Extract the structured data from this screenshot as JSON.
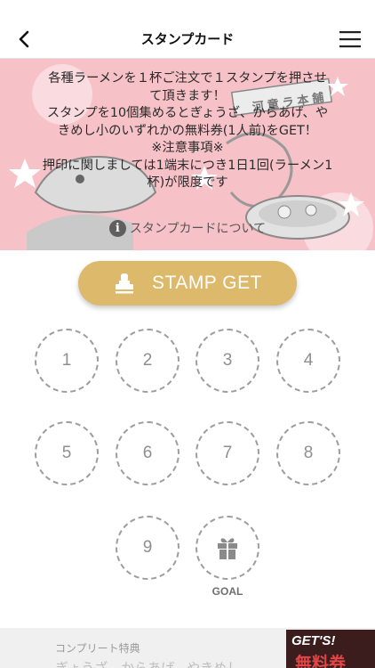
{
  "nav": {
    "title": "スタンプカード"
  },
  "banner": {
    "lines": [
      "各種ラーメンを１杯ご注文で１スタンプを押させ",
      "て頂きます！",
      "スタンプを10個集めるとぎょうざ、からあげ、や",
      "きめし小のいずれかの無料券(1人前)をGET！",
      "※注意事項※",
      "押印に関しましては1端末につき1日1回(ラーメン1",
      "杯)が限度です"
    ],
    "about_label": "スタンプカードについて",
    "sign_text": "河童ラ本舗"
  },
  "stamp_button": {
    "label": "STAMP GET",
    "icon": "stamp-icon"
  },
  "slots": [
    "1",
    "2",
    "3",
    "4",
    "5",
    "6",
    "7",
    "8",
    "9"
  ],
  "goal": {
    "label": "GOAL",
    "icon": "gift-icon"
  },
  "complete": {
    "title": "コンプリート特典",
    "description": "ぎょうざ、からあげ、やきめし"
  },
  "ticket": {
    "top_text": "GET'S!",
    "bottom_text": "無料券"
  },
  "colors": {
    "banner_bg": "#f6c2c8",
    "button_gold": "#ddb96c",
    "slot_border": "#9d9d9d"
  }
}
